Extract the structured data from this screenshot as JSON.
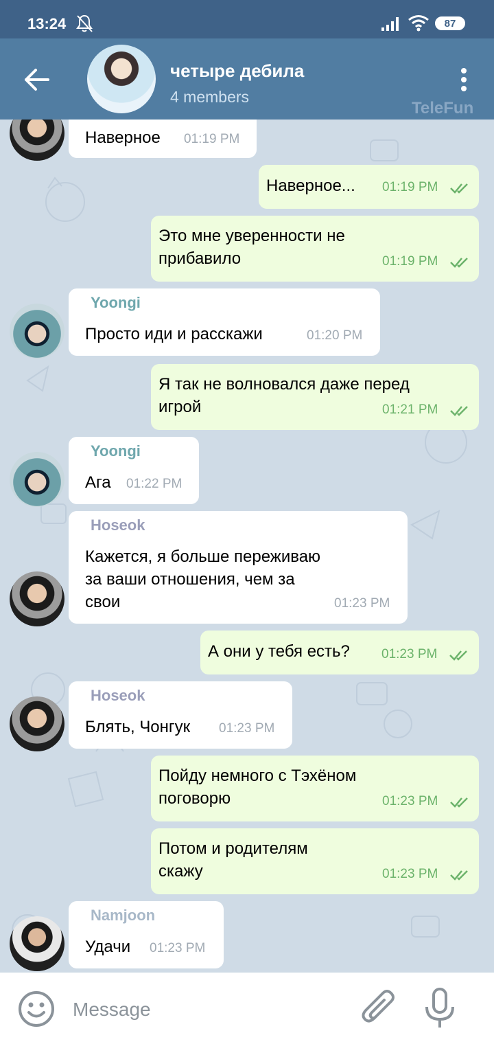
{
  "status_bar": {
    "time": "13:24",
    "battery": "87"
  },
  "header": {
    "title": "четыре дебила",
    "subtitle": "4 members",
    "watermark": "TeleFun"
  },
  "colors": {
    "header": "#517da2",
    "status_bar": "#3f6288",
    "outgoing_bubble": "#effdde",
    "incoming_bubble": "#ffffff",
    "yoongi_name": "#6fa7ad",
    "hoseok_name": "#9a9eb9",
    "namjoon_name": "#a8b8c8",
    "read_check": "#6cb36b"
  },
  "messages": [
    {
      "dir": "in",
      "sender": "",
      "text": "Наверное",
      "time": "01:19 PM"
    },
    {
      "dir": "out",
      "text": "Наверное...",
      "time": "01:19 PM"
    },
    {
      "dir": "out",
      "text": "Это мне уверенности не\nприбавило",
      "time": "01:19 PM"
    },
    {
      "dir": "in",
      "sender": "Yoongi",
      "text": "Просто иди и расскажи",
      "time": "01:20 PM"
    },
    {
      "dir": "out",
      "text": "Я так не волновался даже перед\nигрой",
      "time": "01:21 PM"
    },
    {
      "dir": "in",
      "sender": "Yoongi",
      "text": "Ага",
      "time": "01:22 PM"
    },
    {
      "dir": "in",
      "sender": "Hoseok",
      "text": "Кажется, я больше переживаю\nза ваши отношения, чем за\nсвои",
      "time": "01:23 PM"
    },
    {
      "dir": "out",
      "text": "А они у тебя есть?",
      "time": "01:23 PM"
    },
    {
      "dir": "in",
      "sender": "Hoseok",
      "text": "Блять, Чонгук",
      "time": "01:23 PM"
    },
    {
      "dir": "out",
      "text": "Пойду немного с Тэхёном\nпоговорю",
      "time": "01:23 PM"
    },
    {
      "dir": "out",
      "text": "Потом и родителям\nскажу",
      "time": "01:23 PM"
    },
    {
      "dir": "in",
      "sender": "Namjoon",
      "text": "Удачи",
      "time": "01:23 PM"
    }
  ],
  "input": {
    "placeholder": "Message",
    "value": ""
  }
}
